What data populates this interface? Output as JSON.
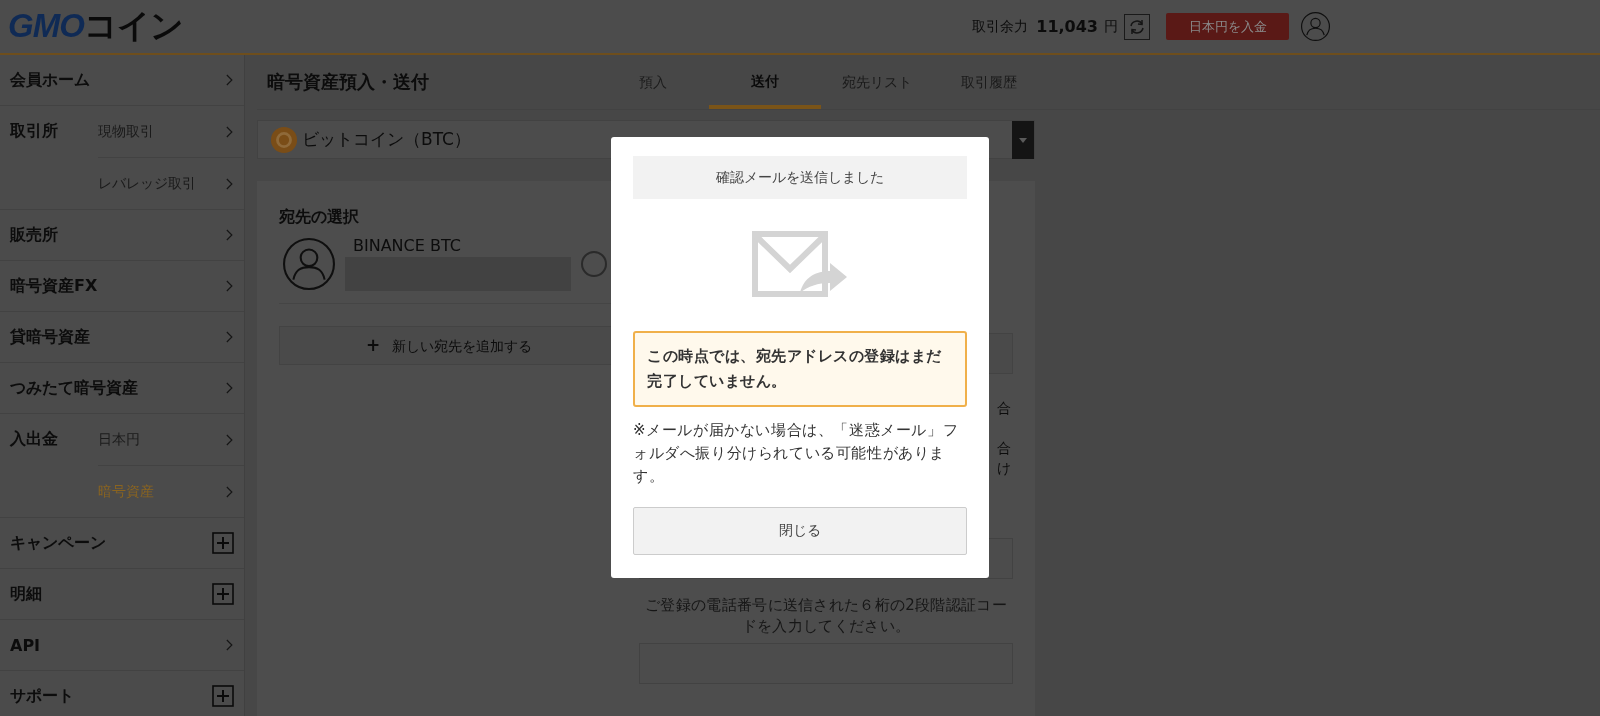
{
  "header": {
    "logo": {
      "brand": "GMO",
      "suffix": "コイン"
    },
    "balance_label": "取引余力",
    "balance_value": "11,043",
    "balance_unit": "円",
    "deposit_button": "日本円を入金"
  },
  "sidebar": {
    "items": [
      {
        "label": "会員ホーム",
        "kind": "link"
      },
      {
        "label": "取引所",
        "kind": "group",
        "children": [
          {
            "label": "現物取引",
            "selected": false
          },
          {
            "label": "レバレッジ取引",
            "selected": false
          }
        ]
      },
      {
        "label": "販売所",
        "kind": "link"
      },
      {
        "label": "暗号資産FX",
        "kind": "link"
      },
      {
        "label": "貸暗号資産",
        "kind": "link"
      },
      {
        "label": "つみたて暗号資産",
        "kind": "link"
      },
      {
        "label": "入出金",
        "kind": "group",
        "children": [
          {
            "label": "日本円",
            "selected": false
          },
          {
            "label": "暗号資産",
            "selected": true
          }
        ]
      },
      {
        "label": "キャンペーン",
        "kind": "expand"
      },
      {
        "label": "明細",
        "kind": "expand"
      },
      {
        "label": "API",
        "kind": "link"
      },
      {
        "label": "サポート",
        "kind": "expand"
      }
    ]
  },
  "page": {
    "title": "暗号資産預入・送付",
    "tabs": [
      {
        "label": "預入",
        "selected": false
      },
      {
        "label": "送付",
        "selected": true
      },
      {
        "label": "宛先リスト",
        "selected": false
      },
      {
        "label": "取引履歴",
        "selected": false
      }
    ],
    "asset_select": {
      "value": "ビットコイン（BTC）"
    },
    "destination": {
      "heading": "宛先の選択",
      "addresses": [
        {
          "name": "BINANCE BTC",
          "selected": false
        }
      ],
      "add_button": "新しい宛先を追加する",
      "add_icon": "+"
    },
    "form": {
      "fragments": [
        "合",
        "合",
        "け"
      ],
      "code_hint": "ご登録の電話番号に送信された６桁の2段階認証コードを入力してください。"
    }
  },
  "dialog": {
    "title": "確認メールを送信しました",
    "warning": "この時点では、宛先アドレスの登録はまだ完了していません。",
    "note": "※メールが届かない場合は、「迷惑メール」フォルダへ振り分けられている可能性があります。",
    "close_button": "閉じる"
  }
}
